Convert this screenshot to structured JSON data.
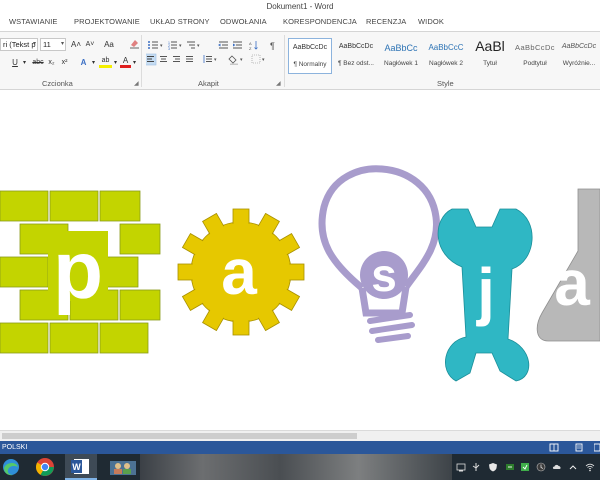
{
  "window": {
    "title": "Dokument1 - Word"
  },
  "ribbon_tabs": [
    {
      "label": "WSTAWIANIE"
    },
    {
      "label": "PROJEKTOWANIE"
    },
    {
      "label": "UKŁAD STRONY"
    },
    {
      "label": "ODWOŁANIA"
    },
    {
      "label": "KORESPONDENCJA"
    },
    {
      "label": "RECENZJA"
    },
    {
      "label": "WIDOK"
    }
  ],
  "font_group": {
    "label": "Czcionka",
    "font_name": "ri (Tekst p",
    "font_size": "11",
    "grow_label": "A˄",
    "shrink_label": "A˅",
    "case_label": "Aa",
    "underline_label": "U",
    "strike_label": "abc",
    "subscript_label": "x₂",
    "superscript_label": "x²",
    "effects_label": "A",
    "highlight_label": "ab",
    "fontcolor_label": "A",
    "bold_hidden": ""
  },
  "paragraph_group": {
    "label": "Akapit",
    "pilcrow": "¶"
  },
  "styles_group": {
    "label": "Style",
    "styles": [
      {
        "preview": "AaBbCcDc",
        "name": "¶ Normalny"
      },
      {
        "preview": "AaBbCcDc",
        "name": "¶ Bez odst..."
      },
      {
        "preview": "AaBbCc",
        "name": "Nagłówek 1"
      },
      {
        "preview": "AaBbCcC",
        "name": "Nagłówek 2"
      },
      {
        "preview": "AaBl",
        "name": "Tytuł"
      },
      {
        "preview": "AaBbCcDc",
        "name": "Podtytuł"
      },
      {
        "preview": "AaBbCcDc",
        "name": "Wyróżnie..."
      }
    ]
  },
  "document": {
    "logo_letters": {
      "p": "p",
      "a": "a",
      "s": "s",
      "j": "j",
      "a2": "a"
    },
    "colors": {
      "brick": "#c3d400",
      "gear": "#e6c800",
      "bulb": "#a89ccc",
      "wrench": "#2fb7c4",
      "flask": "#b8b8b8"
    }
  },
  "statusbar": {
    "language": "POLSKI"
  },
  "colors": {
    "accent": "#2b579a"
  }
}
